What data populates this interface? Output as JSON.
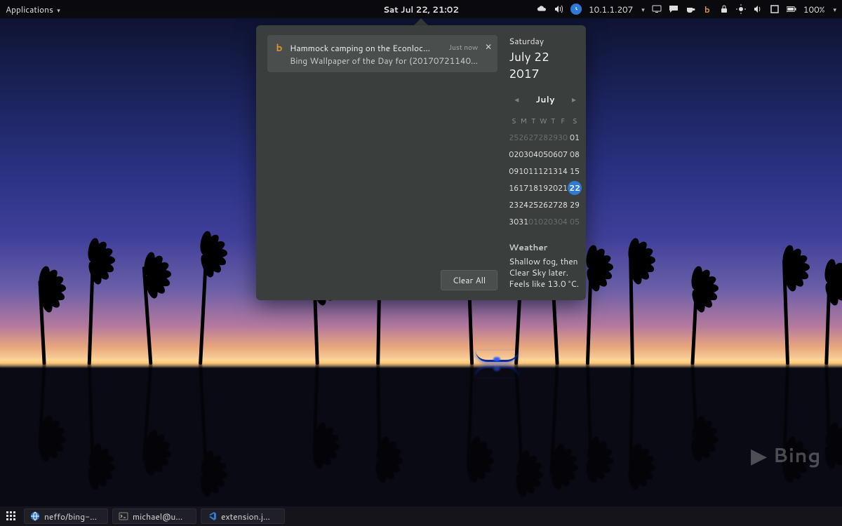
{
  "topbar": {
    "applications_label": "Applications",
    "datetime": "Sat Jul 22, 21:02",
    "ip_address": "10.1.1.207",
    "battery_pct": "100%"
  },
  "popover": {
    "notification": {
      "title": "Hammock camping on the Econloc…",
      "subtitle": "Bing Wallpaper of the Day for (20170721140…",
      "time_label": "Just now"
    },
    "clear_all_label": "Clear All",
    "date": {
      "dow": "Saturday",
      "full": "July 22 2017"
    },
    "calendar": {
      "month_label": "July",
      "dow_headers": [
        "S",
        "M",
        "T",
        "W",
        "T",
        "F",
        "S"
      ],
      "rows": [
        [
          {
            "n": "25",
            "dim": true
          },
          {
            "n": "26",
            "dim": true
          },
          {
            "n": "27",
            "dim": true
          },
          {
            "n": "28",
            "dim": true
          },
          {
            "n": "29",
            "dim": true
          },
          {
            "n": "30",
            "dim": true
          },
          {
            "n": "01"
          }
        ],
        [
          {
            "n": "02"
          },
          {
            "n": "03"
          },
          {
            "n": "04"
          },
          {
            "n": "05"
          },
          {
            "n": "06"
          },
          {
            "n": "07"
          },
          {
            "n": "08"
          }
        ],
        [
          {
            "n": "09"
          },
          {
            "n": "10"
          },
          {
            "n": "11"
          },
          {
            "n": "12"
          },
          {
            "n": "13"
          },
          {
            "n": "14"
          },
          {
            "n": "15"
          }
        ],
        [
          {
            "n": "16"
          },
          {
            "n": "17"
          },
          {
            "n": "18"
          },
          {
            "n": "19"
          },
          {
            "n": "20"
          },
          {
            "n": "21"
          },
          {
            "n": "22",
            "today": true
          }
        ],
        [
          {
            "n": "23"
          },
          {
            "n": "24"
          },
          {
            "n": "25"
          },
          {
            "n": "26"
          },
          {
            "n": "27"
          },
          {
            "n": "28"
          },
          {
            "n": "29"
          }
        ],
        [
          {
            "n": "30"
          },
          {
            "n": "31"
          },
          {
            "n": "01",
            "dim": true
          },
          {
            "n": "02",
            "dim": true
          },
          {
            "n": "03",
            "dim": true
          },
          {
            "n": "04",
            "dim": true
          },
          {
            "n": "05",
            "dim": true
          }
        ]
      ]
    },
    "weather": {
      "heading": "Weather",
      "text": "Shallow fog, then Clear Sky later. Feels like 13.0 °C."
    }
  },
  "taskbar": {
    "items": [
      {
        "icon": "globe",
        "label": "neffo/bing-…"
      },
      {
        "icon": "terminal",
        "label": "michael@u…"
      },
      {
        "icon": "vscode",
        "label": "extension.j…"
      }
    ]
  },
  "watermark": {
    "text": "Bing"
  }
}
